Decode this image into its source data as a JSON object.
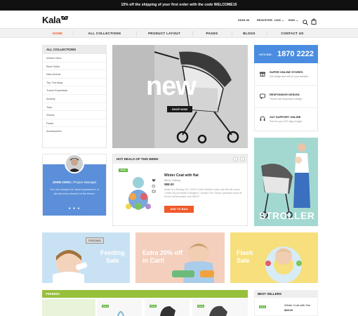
{
  "topbar": {
    "text": "15% off the shipping of your first order with the code WELCOME15"
  },
  "header": {
    "logo": "Kala",
    "signin": "SIGN IN",
    "register": "REGISTER",
    "currency": "USD ⌄",
    "language": "ENG ⌄",
    "icons": [
      "search-icon",
      "cart-icon"
    ]
  },
  "nav": {
    "items": [
      "HOME",
      "ALL COLLECTIONS",
      "PRODUCT LAYOUT",
      "PAGES",
      "BLOGS",
      "CONTACT US"
    ]
  },
  "categories": {
    "title": "ALL COLLECTIONS",
    "items": [
      "What's New",
      "Best Seller",
      "New Arrival",
      "Top Trending",
      "Travel Essentials",
      "Activity",
      "Toys",
      "Shorts",
      "Pants",
      "Accessories"
    ]
  },
  "hero": {
    "word": "new",
    "button": "SHOP NOW"
  },
  "hotline": {
    "label": "HOTLINE:",
    "number": "1870 2222"
  },
  "features": [
    {
      "icon": "gift-icon",
      "title": "SUPER ONLINE STORES",
      "subtitle": "Get bridge and sell on your website."
    },
    {
      "icon": "chat-icon",
      "title": "RESPONSIVE DESIGN",
      "subtitle": "Theme are responsive design."
    },
    {
      "icon": "headset-icon",
      "title": "24/7 SUPPORT ONLINE",
      "subtitle": "Free for you 24/7 day at night"
    }
  ],
  "stroller_banner": {
    "word": "STROLLER"
  },
  "testimonial": {
    "name": "JOHN CENA",
    "role": "Project Manager",
    "quote": "You can change the visual appearance of almost every element of the theme.",
    "dots": "● ● ●"
  },
  "hot_deals": {
    "title": "HOT DEALS OF THIS WEEK",
    "prev": "‹",
    "next": "›",
    "badge": "SALE",
    "product_title": "Winter Coat with Hat",
    "product_category": "Men's Clothing",
    "price": "$88.00",
    "description": "Model is 6 Wearing UK 2 100% Cotton Machine wash cold with like colors Tumble dry low Made in Bangkok, Chinatex The Factory Questions about fit Kontur hq/Neversame.com $69.00",
    "add_button": "ADD TO BAG"
  },
  "promos": [
    {
      "text_line1": "Feeding",
      "text_line2": "Sale",
      "sign": "FEEDING"
    },
    {
      "text_line1": "Extra 20% off",
      "text_line2": "in Cart!"
    },
    {
      "text_line1": "Flash",
      "text_line2": "Sale"
    }
  ],
  "sections": {
    "feeding": "FEEDING",
    "best_sellers": "BEST SELLERS",
    "mini_badge": "SALE",
    "mini_title": "Winter Coat with Hat",
    "mini_price": "$88.00"
  },
  "colors": {
    "accent_blue": "#4a8de0",
    "accent_orange": "#f0592a",
    "accent_green": "#97c03b"
  }
}
